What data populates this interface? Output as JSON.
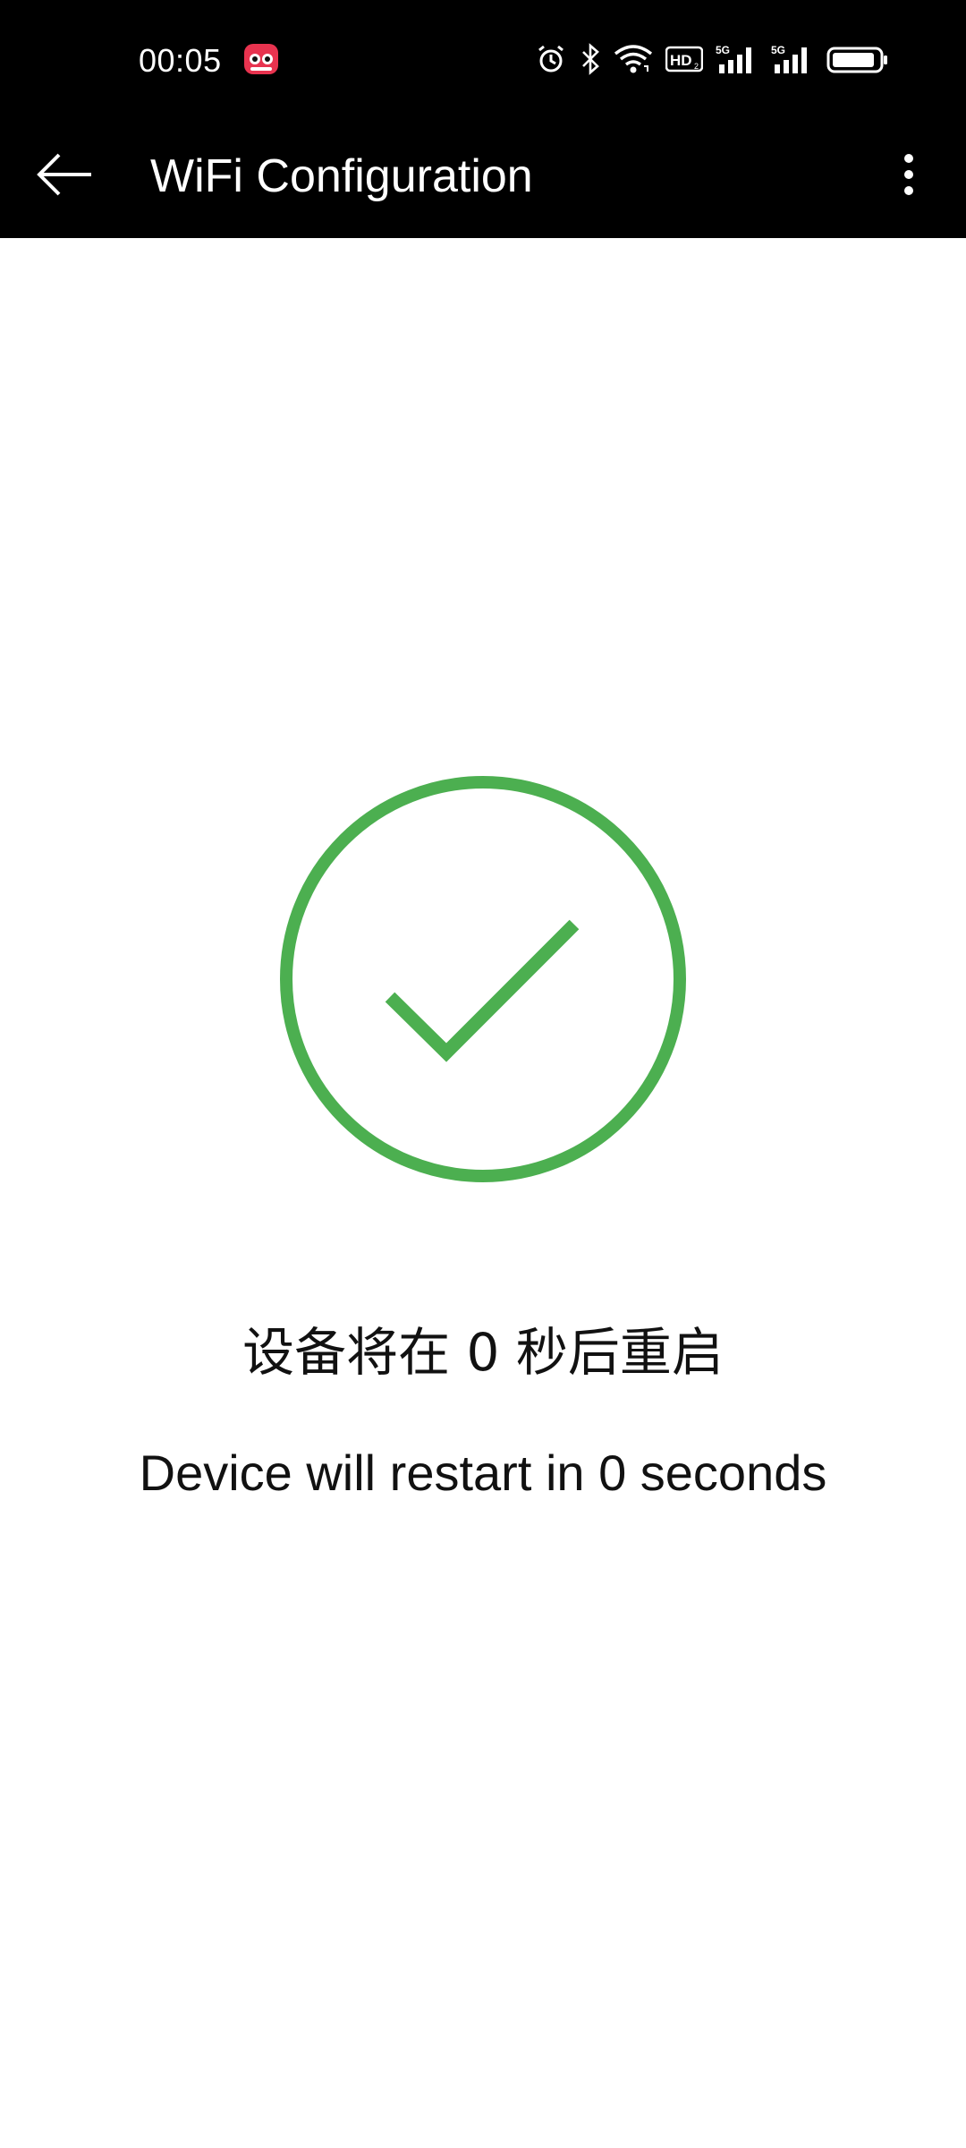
{
  "status_bar": {
    "time": "00:05",
    "icons": [
      "app-badge-icon",
      "alarm-icon",
      "bluetooth-icon",
      "wifi-icon",
      "hd-icon",
      "signal-5g-icon",
      "signal-5g-icon",
      "battery-icon"
    ],
    "hd_label": "HD",
    "hd_sub": "2",
    "net_label_1": "5G",
    "net_label_2": "5G"
  },
  "app_bar": {
    "title": "WiFi Configuration",
    "back_icon": "arrow-back-icon",
    "more_icon": "more-vertical-icon"
  },
  "content": {
    "success_icon": "check-circle-icon",
    "success_color": "#4CAF50",
    "message_cn": "设备将在 0 秒后重启",
    "message_en": "Device will restart in 0 seconds"
  }
}
